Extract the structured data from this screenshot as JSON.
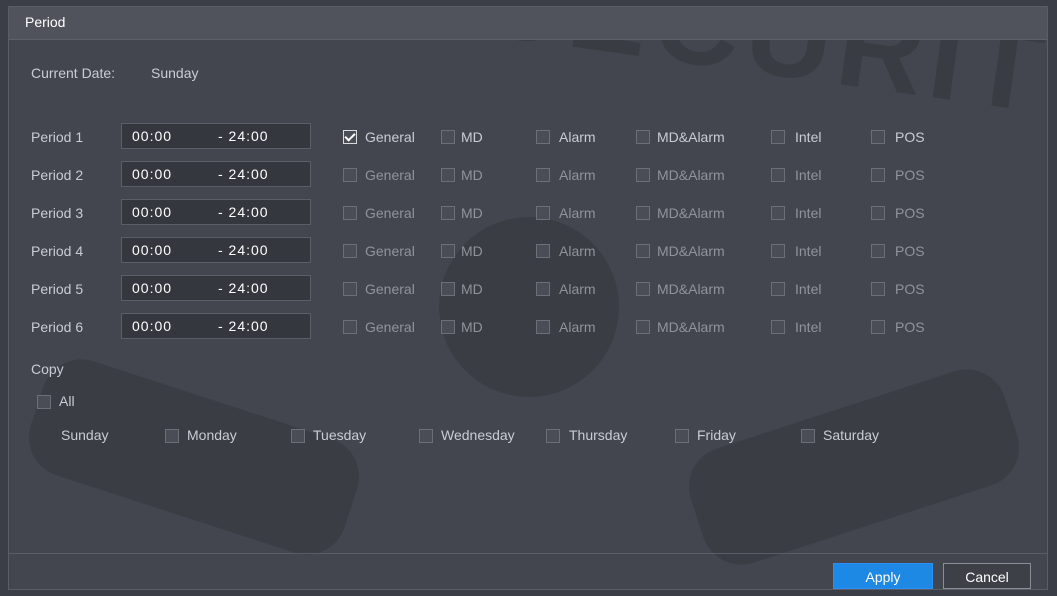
{
  "window": {
    "title": "Period"
  },
  "current_date": {
    "label": "Current Date:",
    "value": "Sunday"
  },
  "option_labels": [
    "General",
    "MD",
    "Alarm",
    "MD&Alarm",
    "Intel",
    "POS"
  ],
  "periods": [
    {
      "label": "Period 1",
      "start": "00:00",
      "end": "- 24:00",
      "checked": [
        true,
        false,
        false,
        false,
        false,
        false
      ]
    },
    {
      "label": "Period 2",
      "start": "00:00",
      "end": "- 24:00",
      "checked": [
        false,
        false,
        false,
        false,
        false,
        false
      ]
    },
    {
      "label": "Period 3",
      "start": "00:00",
      "end": "- 24:00",
      "checked": [
        false,
        false,
        false,
        false,
        false,
        false
      ]
    },
    {
      "label": "Period 4",
      "start": "00:00",
      "end": "- 24:00",
      "checked": [
        false,
        false,
        false,
        false,
        false,
        false
      ]
    },
    {
      "label": "Period 5",
      "start": "00:00",
      "end": "- 24:00",
      "checked": [
        false,
        false,
        false,
        false,
        false,
        false
      ]
    },
    {
      "label": "Period 6",
      "start": "00:00",
      "end": "- 24:00",
      "checked": [
        false,
        false,
        false,
        false,
        false,
        false
      ]
    }
  ],
  "copy": {
    "label": "Copy",
    "all_label": "All",
    "days": [
      "Sunday",
      "Monday",
      "Tuesday",
      "Wednesday",
      "Thursday",
      "Friday",
      "Saturday"
    ]
  },
  "buttons": {
    "apply": "Apply",
    "cancel": "Cancel"
  },
  "watermark": {
    "text": "SAM SECURITY"
  },
  "colors": {
    "accent": "#1e88e5",
    "background": "#43464e",
    "titlebar": "#50535b"
  }
}
